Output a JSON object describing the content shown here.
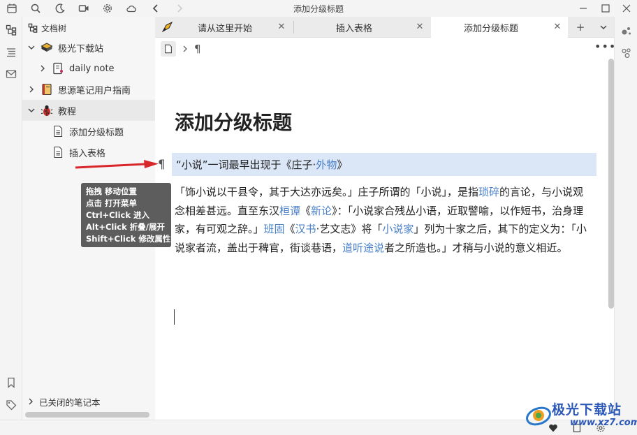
{
  "window": {
    "title": "添加分级标题"
  },
  "titlebar": {
    "icons": [
      "calendar-icon",
      "search-icon",
      "moon-icon",
      "camera-icon",
      "gear-icon",
      "cloud-icon",
      "back-arrow-icon",
      "forward-arrow-icon"
    ],
    "controls": [
      "minimize",
      "maximize",
      "close"
    ]
  },
  "filetree": {
    "header": "文档树",
    "items": [
      {
        "label": "极光下载站",
        "level": 0,
        "expanded": true,
        "icon": "books-icon"
      },
      {
        "label": "daily note",
        "level": 1,
        "expanded": false,
        "icon": "notebook-icon"
      },
      {
        "label": "思源笔记用户指南",
        "level": 0,
        "expanded": false,
        "icon": "guide-book-icon"
      },
      {
        "label": "教程",
        "level": 0,
        "expanded": true,
        "icon": "bug-icon"
      },
      {
        "label": "添加分级标题",
        "level": 1,
        "icon": "document-icon"
      },
      {
        "label": "插入表格",
        "level": 1,
        "icon": "document-icon"
      }
    ],
    "closed_notebooks": "已关闭的笔记本"
  },
  "tabs": [
    {
      "label": "请从这里开始",
      "active": false
    },
    {
      "label": "插入表格",
      "active": false
    },
    {
      "label": "添加分级标题",
      "active": true
    }
  ],
  "editor": {
    "breadcrumb_symbol": "¶",
    "title": "添加分级标题",
    "gutter_symbol": "¶",
    "first_block": {
      "text": "“小说”一词最早出现于《庄子·",
      "link": "外物",
      "tail": "》"
    },
    "paragraph": [
      {
        "t": "「饰小说以干县令，其于大达亦远矣。」庄子所谓的「小说」，是指"
      },
      {
        "t": "琐碎",
        "link": true
      },
      {
        "t": "的言论，与小说观念相差甚远。直至东汉"
      },
      {
        "t": "桓谭",
        "link": true
      },
      {
        "t": "《"
      },
      {
        "t": "新论",
        "link": true
      },
      {
        "t": "》：「小说家合残丛小语，近取譬喻，以作短书，治身理家，有可观之辞。」"
      },
      {
        "t": "班固",
        "link": true
      },
      {
        "t": "《"
      },
      {
        "t": "汉书",
        "link": true
      },
      {
        "t": "·艺文志》将「"
      },
      {
        "t": "小说家",
        "link": true
      },
      {
        "t": "」列为十家之后，其下的定义为：「小说家者流，盖出于稗官，街谈巷语，"
      },
      {
        "t": "道听途说",
        "link": true
      },
      {
        "t": "者之所造也。」才稍与小说的意义相近。"
      }
    ]
  },
  "tooltip": {
    "lines": [
      "拖拽 移动位置",
      "点击 打开菜单",
      "Ctrl+Click 进入",
      "Alt+Click 折叠/展开",
      "Shift+Click 修改属性"
    ]
  },
  "watermark": {
    "text": "极光下载站",
    "url": "www.xz7.com"
  },
  "colors": {
    "accent": "#4a80c8",
    "block_highlight": "#dbe7f7",
    "arrow": "#d9262a",
    "tooltip_bg": "#5d5d5d"
  }
}
